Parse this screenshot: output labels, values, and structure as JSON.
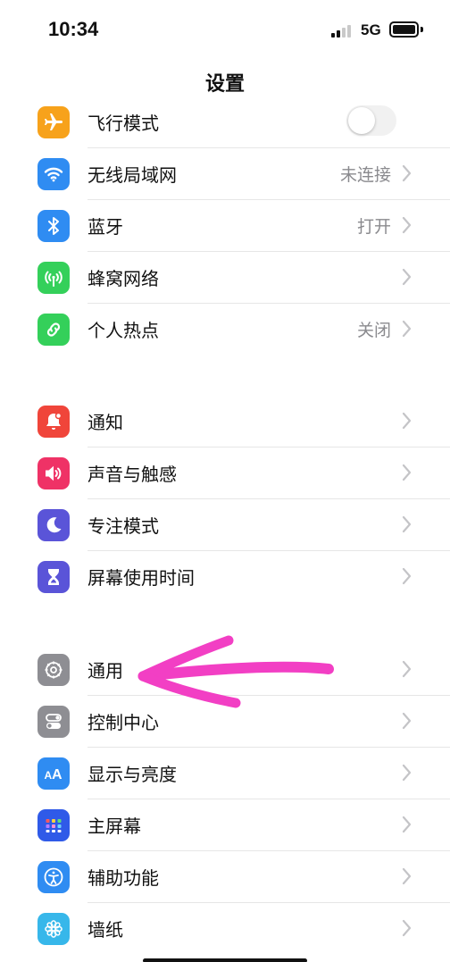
{
  "status_bar": {
    "time": "10:34",
    "network": "5G"
  },
  "header": {
    "title": "设置"
  },
  "groups": [
    {
      "items": [
        {
          "label": "飞行模式",
          "value": "",
          "icon": "airplane-icon",
          "color": "#f7a21b",
          "control": "toggle",
          "state": "off"
        },
        {
          "label": "无线局域网",
          "value": "未连接",
          "icon": "wifi-icon",
          "color": "#2f8cf2"
        },
        {
          "label": "蓝牙",
          "value": "打开",
          "icon": "bluetooth-icon",
          "color": "#2f8cf2"
        },
        {
          "label": "蜂窝网络",
          "value": "",
          "icon": "antenna-icon",
          "color": "#34d05a"
        },
        {
          "label": "个人热点",
          "value": "关闭",
          "icon": "hotspot-icon",
          "color": "#34d05a"
        }
      ]
    },
    {
      "items": [
        {
          "label": "通知",
          "value": "",
          "icon": "bell-icon",
          "color": "#f0453a"
        },
        {
          "label": "声音与触感",
          "value": "",
          "icon": "speaker-icon",
          "color": "#ef3266"
        },
        {
          "label": "专注模式",
          "value": "",
          "icon": "moon-icon",
          "color": "#5a54d8"
        },
        {
          "label": "屏幕使用时间",
          "value": "",
          "icon": "hourglass-icon",
          "color": "#5a54d8"
        }
      ]
    },
    {
      "items": [
        {
          "label": "通用",
          "value": "",
          "icon": "gear-icon",
          "color": "#8e8e93"
        },
        {
          "label": "控制中心",
          "value": "",
          "icon": "toggles-icon",
          "color": "#8e8e93"
        },
        {
          "label": "显示与亮度",
          "value": "",
          "icon": "text-size-icon",
          "color": "#2f8cf2"
        },
        {
          "label": "主屏幕",
          "value": "",
          "icon": "app-grid-icon",
          "color": "#2f5ae8"
        },
        {
          "label": "辅助功能",
          "value": "",
          "icon": "accessibility-icon",
          "color": "#2f8cf2"
        },
        {
          "label": "墙纸",
          "value": "",
          "icon": "flower-icon",
          "color": "#37b7ea"
        }
      ]
    }
  ],
  "annotation": {
    "type": "hand-drawn-arrow",
    "color": "#f23fc4",
    "points_to": "通用"
  }
}
